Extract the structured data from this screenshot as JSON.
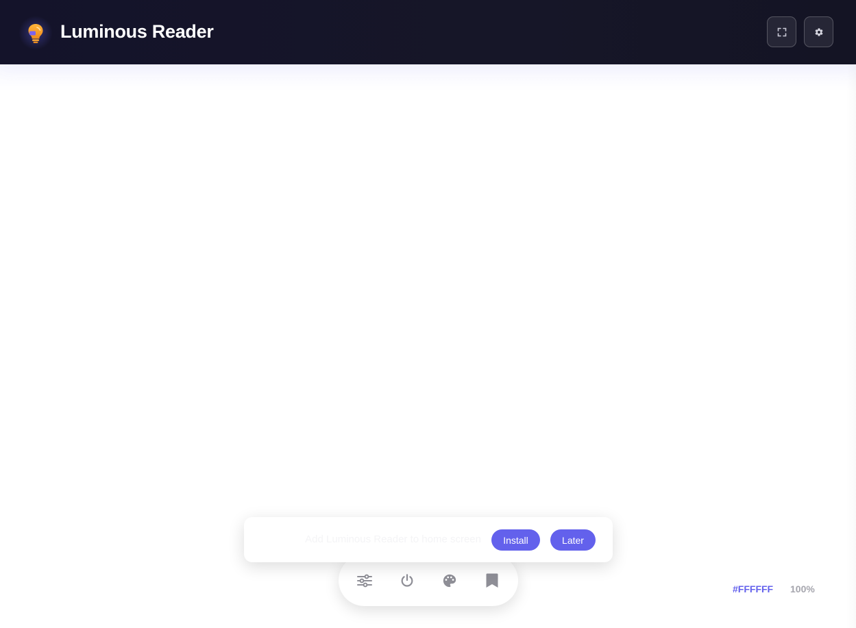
{
  "header": {
    "app_title": "Luminous Reader",
    "logo_icon": "lightbulb-icon",
    "buttons": [
      {
        "name": "fullscreen-button",
        "icon": "fullscreen-icon"
      },
      {
        "name": "settings-button",
        "icon": "gear-icon"
      }
    ]
  },
  "toolbar": {
    "items": [
      {
        "name": "controls",
        "icon": "sliders-icon"
      },
      {
        "name": "power",
        "icon": "power-icon"
      },
      {
        "name": "theme",
        "icon": "palette-icon"
      },
      {
        "name": "bookmark",
        "icon": "bookmark-icon"
      }
    ]
  },
  "install_banner": {
    "message": "Add Luminous Reader to home screen",
    "install_label": "Install",
    "later_label": "Later"
  },
  "status": {
    "color_value": "#FFFFFF",
    "zoom_level": "100%"
  },
  "colors": {
    "accent": "#6361ec",
    "header_bg": "#14132a"
  }
}
